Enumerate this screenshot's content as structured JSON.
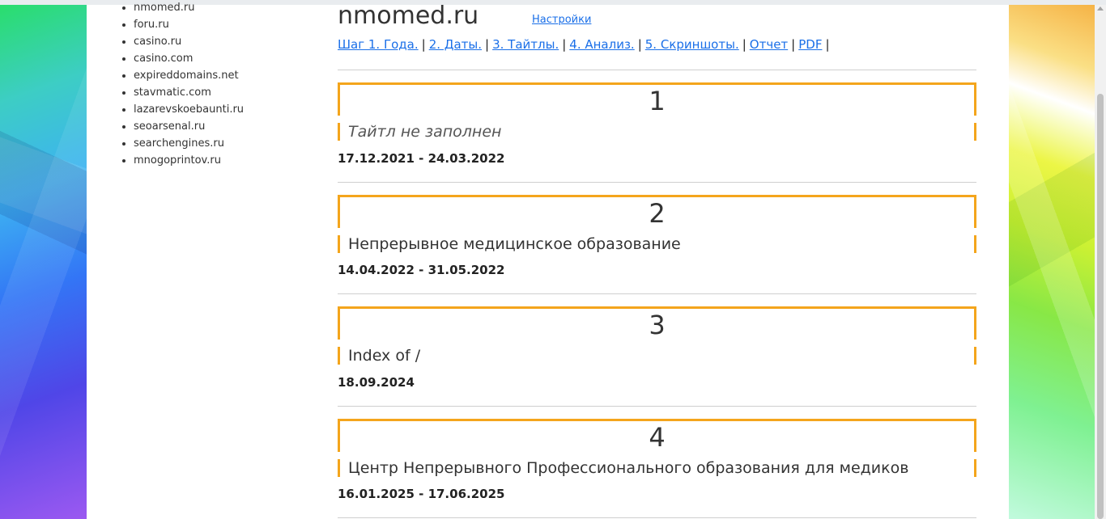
{
  "sidebar": {
    "items": [
      "nmomed.ru",
      "foru.ru",
      "casino.ru",
      "casino.com",
      "expireddomains.net",
      "stavmatic.com",
      "lazarevskoebaunti.ru",
      "seoarsenal.ru",
      "searchengines.ru",
      "mnogoprintov.ru"
    ]
  },
  "header": {
    "title": "nmomed.ru",
    "settings_label": "Настройки"
  },
  "steps": [
    "Шаг 1. Года.",
    "2. Даты.",
    "3. Тайтлы.",
    "4. Анализ.",
    "5. Скриншоты.",
    "Отчет",
    "PDF"
  ],
  "step_separator": "|",
  "periods": [
    {
      "number": "1",
      "title": "Тайтл не заполнен",
      "dates": "17.12.2021 - 24.03.2022"
    },
    {
      "number": "2",
      "title": "Непрерывное медицинское образование",
      "dates": "14.04.2022 - 31.05.2022"
    },
    {
      "number": "3",
      "title": "Index of /",
      "dates": "18.09.2024"
    },
    {
      "number": "4",
      "title": "Центр Непрерывного Профессионального образования для медиков",
      "dates": "16.01.2025 - 17.06.2025"
    }
  ],
  "colors": {
    "accent": "#f4a51c",
    "link": "#1a6fe8"
  }
}
